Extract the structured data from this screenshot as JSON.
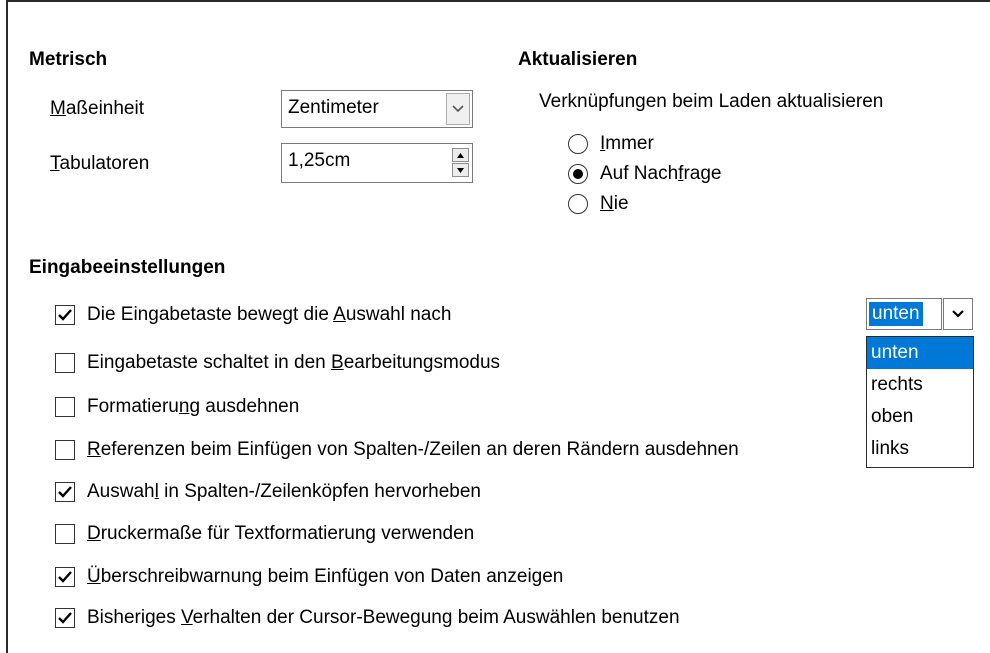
{
  "metric": {
    "heading": "Metrisch",
    "unit": {
      "label_u": "M",
      "label_rest": "aßeinheit",
      "value": "Zentimeter"
    },
    "tabs": {
      "label_u": "T",
      "label_rest": "abulatoren",
      "value": "1,25cm"
    }
  },
  "update": {
    "heading": "Aktualisieren",
    "subtitle": "Verknüpfungen beim Laden aktualisieren",
    "options": [
      {
        "pre": "",
        "u": "I",
        "post": "mmer",
        "selected": false
      },
      {
        "pre": "Auf Nach",
        "u": "f",
        "post": "rage",
        "selected": true
      },
      {
        "pre": "",
        "u": "N",
        "post": "ie",
        "selected": false
      }
    ]
  },
  "input": {
    "heading": "Eingabeeinstellungen",
    "items": [
      {
        "pre": "Die Eingabetaste bewegt die ",
        "u": "A",
        "post": "uswahl nach",
        "checked": true
      },
      {
        "pre": "Eingabetaste schaltet in den ",
        "u": "B",
        "post": "earbeitungsmodus",
        "checked": false
      },
      {
        "pre": "Formatieru",
        "u": "n",
        "post": "g ausdehnen",
        "checked": false
      },
      {
        "pre": "",
        "u": "R",
        "post": "eferenzen beim Einfügen von Spalten-/Zeilen an deren Rändern ausdehnen",
        "checked": false
      },
      {
        "pre": "Auswah",
        "u": "l",
        "post": " in Spalten-/Zeilenköpfen hervorheben",
        "checked": true
      },
      {
        "pre": "",
        "u": "D",
        "post": "ruckermaße für Textformatierung verwenden",
        "checked": false
      },
      {
        "pre": "",
        "u": "Ü",
        "post": "berschreibwarnung beim Einfügen von Daten anzeigen",
        "checked": true
      },
      {
        "pre": "Bisheriges ",
        "u": "V",
        "post": "erhalten der Cursor-Bewegung beim Auswählen benutzen",
        "checked": true
      }
    ],
    "direction": {
      "value": "unten",
      "options": [
        "unten",
        "rechts",
        "oben",
        "links"
      ],
      "selected_index": 0
    }
  },
  "colors": {
    "selection": "#0078d7",
    "border": "#7a7a7a"
  },
  "icons": {
    "dropdown": "chevron-down-icon",
    "spin": "spin-arrows-icon",
    "check": "checkmark-icon"
  }
}
